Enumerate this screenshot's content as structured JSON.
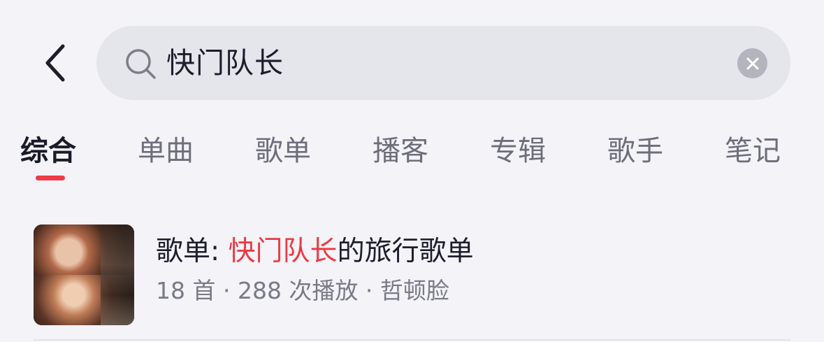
{
  "header": {
    "back_icon": "chevron-left-icon",
    "search": {
      "icon": "search-icon",
      "query": "快门队长",
      "clear_icon": "clear-circle-icon"
    }
  },
  "tabs": [
    {
      "label": "综合",
      "active": true
    },
    {
      "label": "单曲",
      "active": false
    },
    {
      "label": "歌单",
      "active": false
    },
    {
      "label": "播客",
      "active": false
    },
    {
      "label": "专辑",
      "active": false
    },
    {
      "label": "歌手",
      "active": false
    },
    {
      "label": "笔记",
      "active": false
    }
  ],
  "results": [
    {
      "title_prefix": "歌单: ",
      "title_highlight": "快门队长",
      "title_suffix": "的旅行歌单",
      "meta": "18 首 · 288 次播放 · 哲顿脸"
    }
  ],
  "colors": {
    "background": "#f3f3f8",
    "accent": "#ef3b46",
    "search_bg": "#e5e5ec"
  }
}
